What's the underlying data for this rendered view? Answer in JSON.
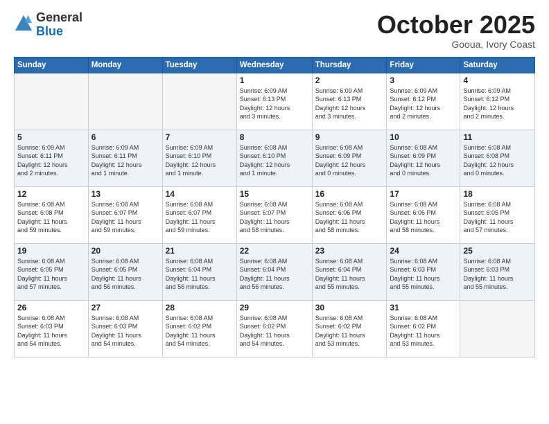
{
  "logo": {
    "general": "General",
    "blue": "Blue"
  },
  "header": {
    "month": "October 2025",
    "location": "Gooua, Ivory Coast"
  },
  "weekdays": [
    "Sunday",
    "Monday",
    "Tuesday",
    "Wednesday",
    "Thursday",
    "Friday",
    "Saturday"
  ],
  "weeks": [
    [
      {
        "day": "",
        "info": ""
      },
      {
        "day": "",
        "info": ""
      },
      {
        "day": "",
        "info": ""
      },
      {
        "day": "1",
        "info": "Sunrise: 6:09 AM\nSunset: 6:13 PM\nDaylight: 12 hours\nand 3 minutes."
      },
      {
        "day": "2",
        "info": "Sunrise: 6:09 AM\nSunset: 6:13 PM\nDaylight: 12 hours\nand 3 minutes."
      },
      {
        "day": "3",
        "info": "Sunrise: 6:09 AM\nSunset: 6:12 PM\nDaylight: 12 hours\nand 2 minutes."
      },
      {
        "day": "4",
        "info": "Sunrise: 6:09 AM\nSunset: 6:12 PM\nDaylight: 12 hours\nand 2 minutes."
      }
    ],
    [
      {
        "day": "5",
        "info": "Sunrise: 6:09 AM\nSunset: 6:11 PM\nDaylight: 12 hours\nand 2 minutes."
      },
      {
        "day": "6",
        "info": "Sunrise: 6:09 AM\nSunset: 6:11 PM\nDaylight: 12 hours\nand 1 minute."
      },
      {
        "day": "7",
        "info": "Sunrise: 6:09 AM\nSunset: 6:10 PM\nDaylight: 12 hours\nand 1 minute."
      },
      {
        "day": "8",
        "info": "Sunrise: 6:08 AM\nSunset: 6:10 PM\nDaylight: 12 hours\nand 1 minute."
      },
      {
        "day": "9",
        "info": "Sunrise: 6:08 AM\nSunset: 6:09 PM\nDaylight: 12 hours\nand 0 minutes."
      },
      {
        "day": "10",
        "info": "Sunrise: 6:08 AM\nSunset: 6:09 PM\nDaylight: 12 hours\nand 0 minutes."
      },
      {
        "day": "11",
        "info": "Sunrise: 6:08 AM\nSunset: 6:08 PM\nDaylight: 12 hours\nand 0 minutes."
      }
    ],
    [
      {
        "day": "12",
        "info": "Sunrise: 6:08 AM\nSunset: 6:08 PM\nDaylight: 11 hours\nand 59 minutes."
      },
      {
        "day": "13",
        "info": "Sunrise: 6:08 AM\nSunset: 6:07 PM\nDaylight: 11 hours\nand 59 minutes."
      },
      {
        "day": "14",
        "info": "Sunrise: 6:08 AM\nSunset: 6:07 PM\nDaylight: 11 hours\nand 59 minutes."
      },
      {
        "day": "15",
        "info": "Sunrise: 6:08 AM\nSunset: 6:07 PM\nDaylight: 11 hours\nand 58 minutes."
      },
      {
        "day": "16",
        "info": "Sunrise: 6:08 AM\nSunset: 6:06 PM\nDaylight: 11 hours\nand 58 minutes."
      },
      {
        "day": "17",
        "info": "Sunrise: 6:08 AM\nSunset: 6:06 PM\nDaylight: 11 hours\nand 58 minutes."
      },
      {
        "day": "18",
        "info": "Sunrise: 6:08 AM\nSunset: 6:05 PM\nDaylight: 11 hours\nand 57 minutes."
      }
    ],
    [
      {
        "day": "19",
        "info": "Sunrise: 6:08 AM\nSunset: 6:05 PM\nDaylight: 11 hours\nand 57 minutes."
      },
      {
        "day": "20",
        "info": "Sunrise: 6:08 AM\nSunset: 6:05 PM\nDaylight: 11 hours\nand 56 minutes."
      },
      {
        "day": "21",
        "info": "Sunrise: 6:08 AM\nSunset: 6:04 PM\nDaylight: 11 hours\nand 56 minutes."
      },
      {
        "day": "22",
        "info": "Sunrise: 6:08 AM\nSunset: 6:04 PM\nDaylight: 11 hours\nand 56 minutes."
      },
      {
        "day": "23",
        "info": "Sunrise: 6:08 AM\nSunset: 6:04 PM\nDaylight: 11 hours\nand 55 minutes."
      },
      {
        "day": "24",
        "info": "Sunrise: 6:08 AM\nSunset: 6:03 PM\nDaylight: 11 hours\nand 55 minutes."
      },
      {
        "day": "25",
        "info": "Sunrise: 6:08 AM\nSunset: 6:03 PM\nDaylight: 11 hours\nand 55 minutes."
      }
    ],
    [
      {
        "day": "26",
        "info": "Sunrise: 6:08 AM\nSunset: 6:03 PM\nDaylight: 11 hours\nand 54 minutes."
      },
      {
        "day": "27",
        "info": "Sunrise: 6:08 AM\nSunset: 6:03 PM\nDaylight: 11 hours\nand 54 minutes."
      },
      {
        "day": "28",
        "info": "Sunrise: 6:08 AM\nSunset: 6:02 PM\nDaylight: 11 hours\nand 54 minutes."
      },
      {
        "day": "29",
        "info": "Sunrise: 6:08 AM\nSunset: 6:02 PM\nDaylight: 11 hours\nand 54 minutes."
      },
      {
        "day": "30",
        "info": "Sunrise: 6:08 AM\nSunset: 6:02 PM\nDaylight: 11 hours\nand 53 minutes."
      },
      {
        "day": "31",
        "info": "Sunrise: 6:08 AM\nSunset: 6:02 PM\nDaylight: 11 hours\nand 53 minutes."
      },
      {
        "day": "",
        "info": ""
      }
    ]
  ]
}
